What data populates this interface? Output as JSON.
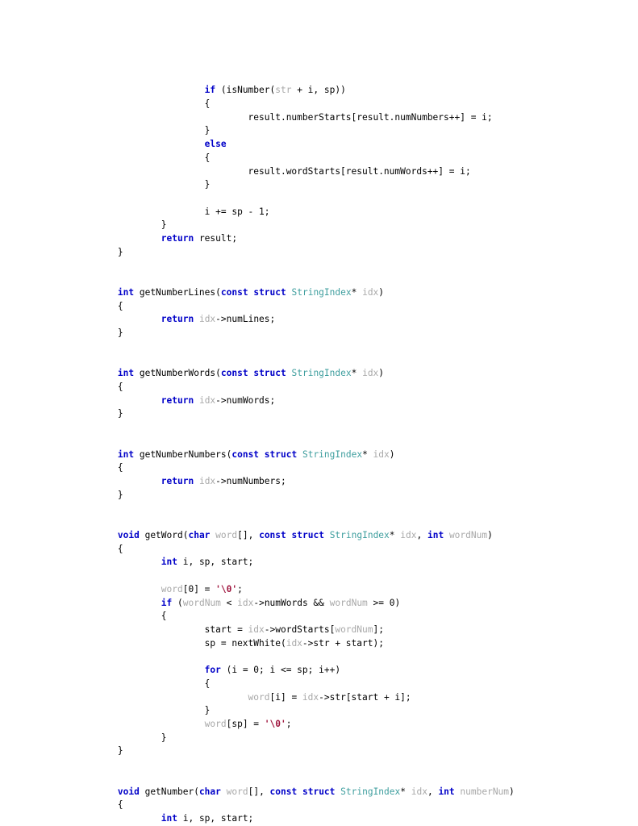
{
  "document": {
    "kind": "source-code-listing",
    "language": "C",
    "background_color": "#ffffff"
  },
  "theme": {
    "keyword_color": "#0000c8",
    "type_color": "#3e9e9e",
    "identifier_color": "#a8a8a8",
    "string_color": "#a01840",
    "plain_color": "#000000"
  },
  "code": {
    "lines": [
      {
        "indent": 3,
        "tokens": [
          {
            "t": "kw",
            "s": "if"
          },
          {
            "t": "pln",
            "s": " (isNumber("
          },
          {
            "t": "var",
            "s": "str"
          },
          {
            "t": "pln",
            "s": " + i, sp))"
          }
        ]
      },
      {
        "indent": 3,
        "tokens": [
          {
            "t": "pln",
            "s": "{"
          }
        ]
      },
      {
        "indent": 4,
        "tokens": [
          {
            "t": "pln",
            "s": "result.numberStarts[result.numNumbers++] = i;"
          }
        ]
      },
      {
        "indent": 3,
        "tokens": [
          {
            "t": "pln",
            "s": "}"
          }
        ]
      },
      {
        "indent": 3,
        "tokens": [
          {
            "t": "kw",
            "s": "else"
          }
        ]
      },
      {
        "indent": 3,
        "tokens": [
          {
            "t": "pln",
            "s": "{"
          }
        ]
      },
      {
        "indent": 4,
        "tokens": [
          {
            "t": "pln",
            "s": "result.wordStarts[result.numWords++] = i;"
          }
        ]
      },
      {
        "indent": 3,
        "tokens": [
          {
            "t": "pln",
            "s": "}"
          }
        ]
      },
      {
        "indent": 0,
        "tokens": []
      },
      {
        "indent": 3,
        "tokens": [
          {
            "t": "pln",
            "s": "i += sp - 1;"
          }
        ]
      },
      {
        "indent": 2,
        "tokens": [
          {
            "t": "pln",
            "s": "}"
          }
        ]
      },
      {
        "indent": 2,
        "tokens": [
          {
            "t": "kw",
            "s": "return"
          },
          {
            "t": "pln",
            "s": " result;"
          }
        ]
      },
      {
        "indent": 1,
        "tokens": [
          {
            "t": "pln",
            "s": "}"
          }
        ]
      },
      {
        "indent": 0,
        "tokens": []
      },
      {
        "indent": 0,
        "tokens": []
      },
      {
        "indent": 1,
        "tokens": [
          {
            "t": "kw",
            "s": "int"
          },
          {
            "t": "pln",
            "s": " getNumberLines("
          },
          {
            "t": "kw",
            "s": "const"
          },
          {
            "t": "pln",
            "s": " "
          },
          {
            "t": "kw",
            "s": "struct"
          },
          {
            "t": "pln",
            "s": " "
          },
          {
            "t": "typ",
            "s": "StringIndex"
          },
          {
            "t": "pln",
            "s": "* "
          },
          {
            "t": "var",
            "s": "idx"
          },
          {
            "t": "pln",
            "s": ")"
          }
        ]
      },
      {
        "indent": 1,
        "tokens": [
          {
            "t": "pln",
            "s": "{"
          }
        ]
      },
      {
        "indent": 2,
        "tokens": [
          {
            "t": "kw",
            "s": "return"
          },
          {
            "t": "pln",
            "s": " "
          },
          {
            "t": "var",
            "s": "idx"
          },
          {
            "t": "pln",
            "s": "->numLines;"
          }
        ]
      },
      {
        "indent": 1,
        "tokens": [
          {
            "t": "pln",
            "s": "}"
          }
        ]
      },
      {
        "indent": 0,
        "tokens": []
      },
      {
        "indent": 0,
        "tokens": []
      },
      {
        "indent": 1,
        "tokens": [
          {
            "t": "kw",
            "s": "int"
          },
          {
            "t": "pln",
            "s": " getNumberWords("
          },
          {
            "t": "kw",
            "s": "const"
          },
          {
            "t": "pln",
            "s": " "
          },
          {
            "t": "kw",
            "s": "struct"
          },
          {
            "t": "pln",
            "s": " "
          },
          {
            "t": "typ",
            "s": "StringIndex"
          },
          {
            "t": "pln",
            "s": "* "
          },
          {
            "t": "var",
            "s": "idx"
          },
          {
            "t": "pln",
            "s": ")"
          }
        ]
      },
      {
        "indent": 1,
        "tokens": [
          {
            "t": "pln",
            "s": "{"
          }
        ]
      },
      {
        "indent": 2,
        "tokens": [
          {
            "t": "kw",
            "s": "return"
          },
          {
            "t": "pln",
            "s": " "
          },
          {
            "t": "var",
            "s": "idx"
          },
          {
            "t": "pln",
            "s": "->numWords;"
          }
        ]
      },
      {
        "indent": 1,
        "tokens": [
          {
            "t": "pln",
            "s": "}"
          }
        ]
      },
      {
        "indent": 0,
        "tokens": []
      },
      {
        "indent": 0,
        "tokens": []
      },
      {
        "indent": 1,
        "tokens": [
          {
            "t": "kw",
            "s": "int"
          },
          {
            "t": "pln",
            "s": " getNumberNumbers("
          },
          {
            "t": "kw",
            "s": "const"
          },
          {
            "t": "pln",
            "s": " "
          },
          {
            "t": "kw",
            "s": "struct"
          },
          {
            "t": "pln",
            "s": " "
          },
          {
            "t": "typ",
            "s": "StringIndex"
          },
          {
            "t": "pln",
            "s": "* "
          },
          {
            "t": "var",
            "s": "idx"
          },
          {
            "t": "pln",
            "s": ")"
          }
        ]
      },
      {
        "indent": 1,
        "tokens": [
          {
            "t": "pln",
            "s": "{"
          }
        ]
      },
      {
        "indent": 2,
        "tokens": [
          {
            "t": "kw",
            "s": "return"
          },
          {
            "t": "pln",
            "s": " "
          },
          {
            "t": "var",
            "s": "idx"
          },
          {
            "t": "pln",
            "s": "->numNumbers;"
          }
        ]
      },
      {
        "indent": 1,
        "tokens": [
          {
            "t": "pln",
            "s": "}"
          }
        ]
      },
      {
        "indent": 0,
        "tokens": []
      },
      {
        "indent": 0,
        "tokens": []
      },
      {
        "indent": 1,
        "tokens": [
          {
            "t": "kw",
            "s": "void"
          },
          {
            "t": "pln",
            "s": " getWord("
          },
          {
            "t": "kw",
            "s": "char"
          },
          {
            "t": "pln",
            "s": " "
          },
          {
            "t": "var",
            "s": "word"
          },
          {
            "t": "pln",
            "s": "[], "
          },
          {
            "t": "kw",
            "s": "const"
          },
          {
            "t": "pln",
            "s": " "
          },
          {
            "t": "kw",
            "s": "struct"
          },
          {
            "t": "pln",
            "s": " "
          },
          {
            "t": "typ",
            "s": "StringIndex"
          },
          {
            "t": "pln",
            "s": "* "
          },
          {
            "t": "var",
            "s": "idx"
          },
          {
            "t": "pln",
            "s": ", "
          },
          {
            "t": "kw",
            "s": "int"
          },
          {
            "t": "pln",
            "s": " "
          },
          {
            "t": "var",
            "s": "wordNum"
          },
          {
            "t": "pln",
            "s": ")"
          }
        ]
      },
      {
        "indent": 1,
        "tokens": [
          {
            "t": "pln",
            "s": "{"
          }
        ]
      },
      {
        "indent": 2,
        "tokens": [
          {
            "t": "kw",
            "s": "int"
          },
          {
            "t": "pln",
            "s": " i, sp, start;"
          }
        ]
      },
      {
        "indent": 0,
        "tokens": []
      },
      {
        "indent": 2,
        "tokens": [
          {
            "t": "var",
            "s": "word"
          },
          {
            "t": "pln",
            "s": "[0] = "
          },
          {
            "t": "str",
            "s": "'\\0'"
          },
          {
            "t": "pln",
            "s": ";"
          }
        ]
      },
      {
        "indent": 2,
        "tokens": [
          {
            "t": "kw",
            "s": "if"
          },
          {
            "t": "pln",
            "s": " ("
          },
          {
            "t": "var",
            "s": "wordNum"
          },
          {
            "t": "pln",
            "s": " < "
          },
          {
            "t": "var",
            "s": "idx"
          },
          {
            "t": "pln",
            "s": "->numWords && "
          },
          {
            "t": "var",
            "s": "wordNum"
          },
          {
            "t": "pln",
            "s": " >= 0)"
          }
        ]
      },
      {
        "indent": 2,
        "tokens": [
          {
            "t": "pln",
            "s": "{"
          }
        ]
      },
      {
        "indent": 3,
        "tokens": [
          {
            "t": "pln",
            "s": "start = "
          },
          {
            "t": "var",
            "s": "idx"
          },
          {
            "t": "pln",
            "s": "->wordStarts["
          },
          {
            "t": "var",
            "s": "wordNum"
          },
          {
            "t": "pln",
            "s": "];"
          }
        ]
      },
      {
        "indent": 3,
        "tokens": [
          {
            "t": "pln",
            "s": "sp = nextWhite("
          },
          {
            "t": "var",
            "s": "idx"
          },
          {
            "t": "pln",
            "s": "->str + start);"
          }
        ]
      },
      {
        "indent": 0,
        "tokens": []
      },
      {
        "indent": 3,
        "tokens": [
          {
            "t": "kw",
            "s": "for"
          },
          {
            "t": "pln",
            "s": " (i = 0; i <= sp; i++)"
          }
        ]
      },
      {
        "indent": 3,
        "tokens": [
          {
            "t": "pln",
            "s": "{"
          }
        ]
      },
      {
        "indent": 4,
        "tokens": [
          {
            "t": "var",
            "s": "word"
          },
          {
            "t": "pln",
            "s": "[i] = "
          },
          {
            "t": "var",
            "s": "idx"
          },
          {
            "t": "pln",
            "s": "->str[start + i];"
          }
        ]
      },
      {
        "indent": 3,
        "tokens": [
          {
            "t": "pln",
            "s": "}"
          }
        ]
      },
      {
        "indent": 3,
        "tokens": [
          {
            "t": "var",
            "s": "word"
          },
          {
            "t": "pln",
            "s": "[sp] = "
          },
          {
            "t": "str",
            "s": "'\\0'"
          },
          {
            "t": "pln",
            "s": ";"
          }
        ]
      },
      {
        "indent": 2,
        "tokens": [
          {
            "t": "pln",
            "s": "}"
          }
        ]
      },
      {
        "indent": 1,
        "tokens": [
          {
            "t": "pln",
            "s": "}"
          }
        ]
      },
      {
        "indent": 0,
        "tokens": []
      },
      {
        "indent": 0,
        "tokens": []
      },
      {
        "indent": 1,
        "tokens": [
          {
            "t": "kw",
            "s": "void"
          },
          {
            "t": "pln",
            "s": " getNumber("
          },
          {
            "t": "kw",
            "s": "char"
          },
          {
            "t": "pln",
            "s": " "
          },
          {
            "t": "var",
            "s": "word"
          },
          {
            "t": "pln",
            "s": "[], "
          },
          {
            "t": "kw",
            "s": "const"
          },
          {
            "t": "pln",
            "s": " "
          },
          {
            "t": "kw",
            "s": "struct"
          },
          {
            "t": "pln",
            "s": " "
          },
          {
            "t": "typ",
            "s": "StringIndex"
          },
          {
            "t": "pln",
            "s": "* "
          },
          {
            "t": "var",
            "s": "idx"
          },
          {
            "t": "pln",
            "s": ", "
          },
          {
            "t": "kw",
            "s": "int"
          },
          {
            "t": "pln",
            "s": " "
          },
          {
            "t": "var",
            "s": "numberNum"
          },
          {
            "t": "pln",
            "s": ")"
          }
        ]
      },
      {
        "indent": 1,
        "tokens": [
          {
            "t": "pln",
            "s": "{"
          }
        ]
      },
      {
        "indent": 2,
        "tokens": [
          {
            "t": "kw",
            "s": "int"
          },
          {
            "t": "pln",
            "s": " i, sp, start;"
          }
        ]
      }
    ]
  }
}
